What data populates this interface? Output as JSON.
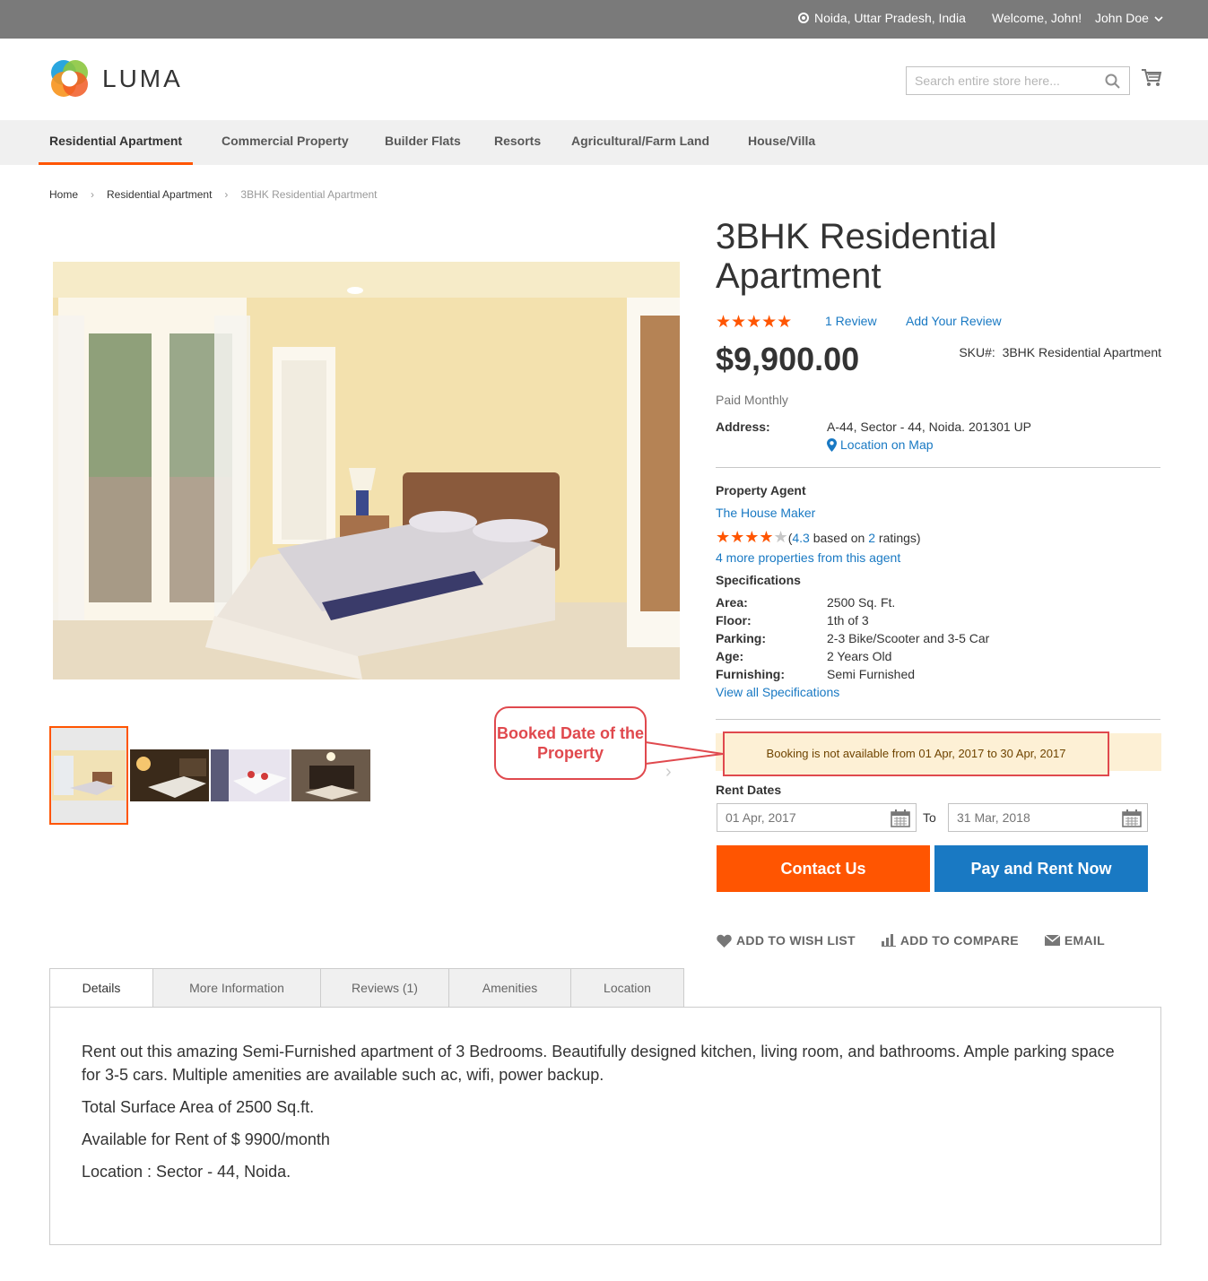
{
  "topbar": {
    "location": "Noida, Uttar Pradesh, India",
    "welcome": "Welcome, John!",
    "user": "John Doe"
  },
  "header": {
    "logo_text": "LUMA",
    "search_placeholder": "Search entire store here..."
  },
  "nav": {
    "items": [
      {
        "label": "Residential Apartment"
      },
      {
        "label": "Commercial Property"
      },
      {
        "label": "Builder Flats"
      },
      {
        "label": "Resorts"
      },
      {
        "label": "Agricultural/Farm Land"
      },
      {
        "label": "House/Villa"
      }
    ]
  },
  "breadcrumb": {
    "home": "Home",
    "category": "Residential Apartment",
    "current": "3BHK Residential Apartment"
  },
  "product": {
    "title": "3BHK Residential Apartment",
    "stars": "★★★★★",
    "review_count": "1 Review",
    "add_review": "Add Your Review",
    "price": "$9,900.00",
    "sku_label": "SKU#:",
    "sku_value": "3BHK Residential Apartment",
    "paid": "Paid Monthly",
    "address_label": "Address:",
    "address_value": "A-44, Sector - 44, Noida. 201301 UP",
    "map_link": "Location on Map"
  },
  "agent": {
    "heading": "Property Agent",
    "name": "The House Maker",
    "stars_on": "★★★★",
    "stars_off": "★",
    "rating_open": "(",
    "rating_value": "4.3",
    "rating_mid": " based on ",
    "rating_count": "2",
    "rating_close": " ratings)",
    "rating": 4.3,
    "more": "4 more properties from this agent"
  },
  "specs": {
    "heading": "Specifications",
    "rows": [
      {
        "k": "Area:",
        "v": "2500 Sq. Ft."
      },
      {
        "k": "Floor:",
        "v": "1th of 3"
      },
      {
        "k": "Parking:",
        "v": "2-3 Bike/Scooter and 3-5 Car"
      },
      {
        "k": "Age:",
        "v": "2 Years Old"
      },
      {
        "k": "Furnishing:",
        "v": "Semi Furnished"
      }
    ],
    "view_all": "View all Specifications"
  },
  "booking": {
    "notice": "Booking is not available from 01 Apr, 2017 to 30 Apr, 2017",
    "callout": "Booked Date of the Property",
    "rent_label": "Rent Dates",
    "from_placeholder": "01 Apr, 2017",
    "to_label": "To",
    "to_placeholder": "31 Mar, 2018",
    "contact_button": "Contact Us",
    "pay_button": "Pay and Rent Now"
  },
  "actions": {
    "wishlist": "ADD TO WISH LIST",
    "compare": "ADD TO COMPARE",
    "email": "EMAIL"
  },
  "tabs": [
    {
      "label": "Details"
    },
    {
      "label": "More Information"
    },
    {
      "label": "Reviews (1)"
    },
    {
      "label": "Amenities"
    },
    {
      "label": "Location"
    }
  ],
  "details": {
    "p1": "Rent out this amazing Semi-Furnished apartment of 3 Bedrooms. Beautifully designed kitchen, living room, and bathrooms. Ample parking space for 3-5 cars. Multiple amenities are available such ac, wifi, power backup.",
    "p2": "Total Surface Area of 2500 Sq.ft.",
    "p3": "Available for Rent of $ 9900/month",
    "p4": "Location : Sector - 44, Noida."
  },
  "colors": {
    "accent": "#ff5501",
    "link": "#1979c3",
    "callout": "#e0494e",
    "topbar": "#7a7a7a"
  }
}
